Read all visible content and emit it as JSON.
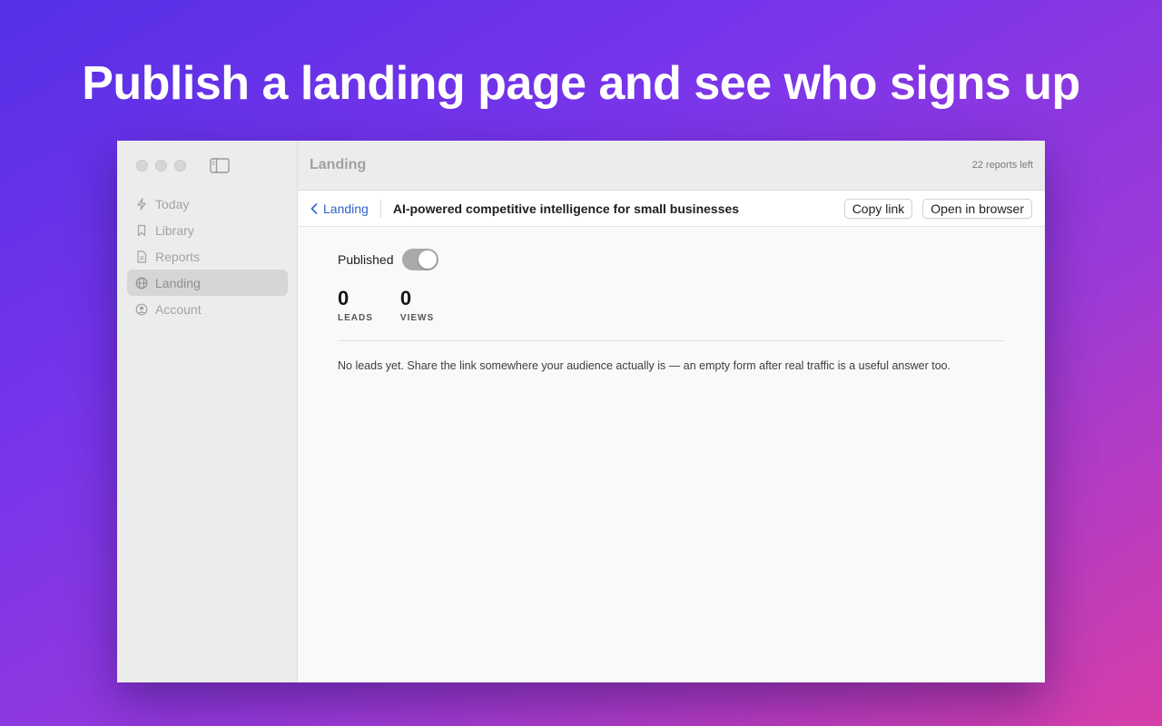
{
  "headline": "Publish a landing page and see who signs up",
  "sidebar": {
    "items": [
      {
        "label": "Today",
        "icon": "bolt-icon"
      },
      {
        "label": "Library",
        "icon": "bookmark-icon"
      },
      {
        "label": "Reports",
        "icon": "document-icon"
      },
      {
        "label": "Landing",
        "icon": "globe-icon",
        "active": true
      },
      {
        "label": "Account",
        "icon": "person-circle-icon"
      }
    ]
  },
  "titlebar": {
    "title": "Landing",
    "credits": "22 reports left"
  },
  "toolbar": {
    "back_label": "Landing",
    "page_name": "AI-powered competitive intelligence for small businesses",
    "copy_label": "Copy link",
    "open_label": "Open in browser"
  },
  "content": {
    "published_label": "Published",
    "published": true,
    "leads_count": "0",
    "leads_label": "LEADS",
    "views_count": "0",
    "views_label": "VIEWS",
    "empty_message": "No leads yet. Share the link somewhere your audience actually is — an empty form after real traffic is a useful answer too."
  },
  "colors": {
    "accent_link": "#2f63c9",
    "toggle_on": "#a9a9a9"
  }
}
